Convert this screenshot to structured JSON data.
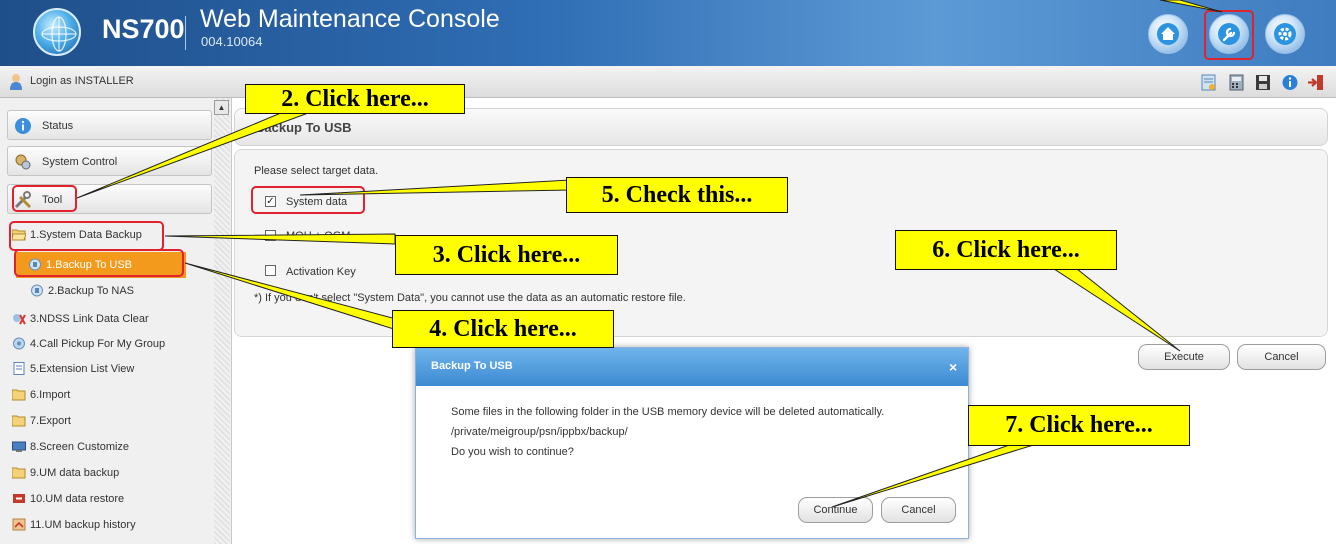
{
  "header": {
    "product": "NS700",
    "console_title": "Web Maintenance Console",
    "version": "004.10064",
    "icons": [
      "home-icon",
      "wrench-icon",
      "gear-icon"
    ]
  },
  "toolbar": {
    "login_text": "Login as INSTALLER",
    "icons": [
      "notepad-icon",
      "phone-book-icon",
      "save-icon",
      "info-icon",
      "logout-icon"
    ]
  },
  "sidebar": {
    "status": "Status",
    "system_control": "System Control",
    "tool": "Tool",
    "tree": [
      {
        "label": "1.System Data Backup",
        "icon": "folder-open-icon"
      },
      {
        "label": "1.Backup To USB",
        "icon": "usb-icon",
        "selected": true
      },
      {
        "label": "2.Backup To NAS",
        "icon": "nas-icon"
      },
      {
        "label": "3.NDSS Link Data Clear",
        "icon": "link-clear-icon"
      },
      {
        "label": "4.Call Pickup For My Group",
        "icon": "pickup-icon"
      },
      {
        "label": "5.Extension List View",
        "icon": "list-icon"
      },
      {
        "label": "6.Import",
        "icon": "folder-icon"
      },
      {
        "label": "7.Export",
        "icon": "folder-icon"
      },
      {
        "label": "8.Screen Customize",
        "icon": "screen-icon"
      },
      {
        "label": "9.UM data backup",
        "icon": "folder-icon"
      },
      {
        "label": "10.UM data restore",
        "icon": "restore-icon"
      },
      {
        "label": "11.UM backup history",
        "icon": "history-icon"
      }
    ]
  },
  "main": {
    "page_title": "Backup To USB",
    "instruction": "Please select target data.",
    "options": [
      {
        "label": "System data",
        "checked": true
      },
      {
        "label": "MOH + OGM",
        "checked": false
      },
      {
        "label": "Activation Key",
        "checked": false
      }
    ],
    "note": "*) If you don't select \"System Data\", you cannot use the data as an automatic restore file.",
    "execute": "Execute",
    "cancel": "Cancel"
  },
  "dialog": {
    "title": "Backup To USB",
    "close": "×",
    "line1": "Some files in the following folder in the USB memory device will be deleted automatically.",
    "line2": "/private/meigroup/psn/ippbx/backup/",
    "line3": "Do you wish to continue?",
    "continue": "Continue",
    "cancel": "Cancel"
  },
  "callouts": {
    "c2": "2. Click here...",
    "c3": "3. Click here...",
    "c4": "4. Click here...",
    "c5": "5. Check this...",
    "c6": "6. Click here...",
    "c7": "7. Click here..."
  }
}
